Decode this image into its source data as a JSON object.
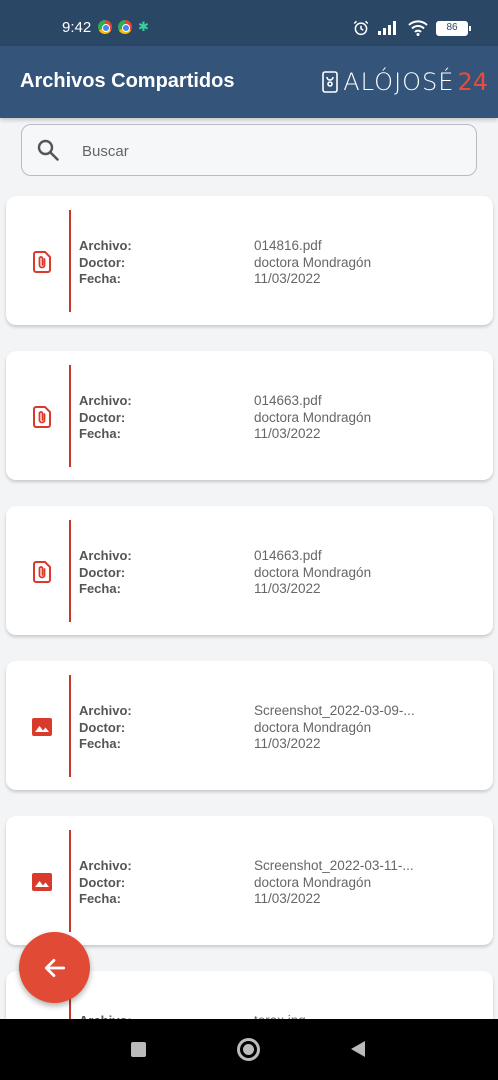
{
  "status_bar": {
    "time": "9:42",
    "battery": "86"
  },
  "app_bar": {
    "title": "Archivos Compartidos",
    "logo_text": "ALÓJOSÉ",
    "logo_number": "24"
  },
  "search": {
    "placeholder": "Buscar",
    "value": ""
  },
  "labels": {
    "file": "Archivo:",
    "doctor": "Doctor:",
    "date": "Fecha:"
  },
  "files": [
    {
      "icon": "attachment-file-icon",
      "name": "014816.pdf",
      "doctor": "doctora Mondragón",
      "date": "11/03/2022"
    },
    {
      "icon": "attachment-file-icon",
      "name": "014663.pdf",
      "doctor": "doctora Mondragón",
      "date": "11/03/2022"
    },
    {
      "icon": "attachment-file-icon",
      "name": "014663.pdf",
      "doctor": "doctora Mondragón",
      "date": "11/03/2022"
    },
    {
      "icon": "image-file-icon",
      "name": "Screenshot_2022-03-09-...",
      "doctor": "doctora Mondragón",
      "date": "11/03/2022"
    },
    {
      "icon": "image-file-icon",
      "name": "Screenshot_2022-03-11-...",
      "doctor": "doctora Mondragón",
      "date": "11/03/2022"
    },
    {
      "icon": "image-file-icon",
      "name": "torax.jpg",
      "doctor": "",
      "date": ""
    }
  ],
  "colors": {
    "status_bar": "#2a4766",
    "app_bar": "#345479",
    "accent": "#d93a2b",
    "fab": "#e14b35"
  }
}
